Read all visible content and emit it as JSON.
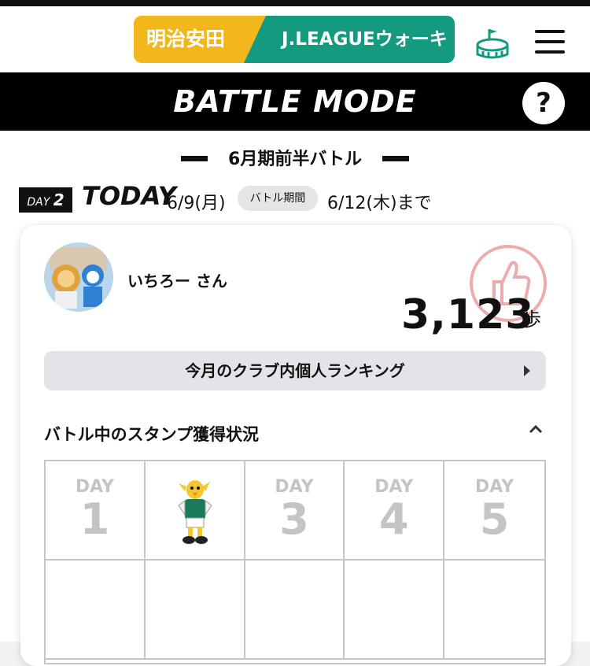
{
  "header": {
    "logo_left": "明治安田",
    "logo_right": "J.LEAGUEウォーキング",
    "stadium_icon": "stadium-icon",
    "menu_icon": "hamburger-menu-icon",
    "colors": {
      "logo_yellow": "#f3b71e",
      "logo_green": "#149a7f"
    }
  },
  "battle": {
    "title": "BATTLE MODE",
    "help_label": "?"
  },
  "period": {
    "title": "6月期前半バトル",
    "day_prefix": "DAY",
    "day_number": "2",
    "today_label": "TODAY",
    "date": "6/9(月)",
    "period_label": "バトル期間",
    "until": "6/12(木)まで"
  },
  "user": {
    "name": "いちろー さん",
    "steps": "3,123",
    "steps_unit": "歩"
  },
  "ranking_button": "今月のクラブ内個人ランキング",
  "stamps": {
    "title": "バトル中のスタンプ獲得状況",
    "cells": [
      {
        "label": "DAY",
        "num": "1"
      },
      {
        "label": "",
        "num": ""
      },
      {
        "label": "DAY",
        "num": "3"
      },
      {
        "label": "DAY",
        "num": "4"
      },
      {
        "label": "DAY",
        "num": "5"
      }
    ]
  }
}
